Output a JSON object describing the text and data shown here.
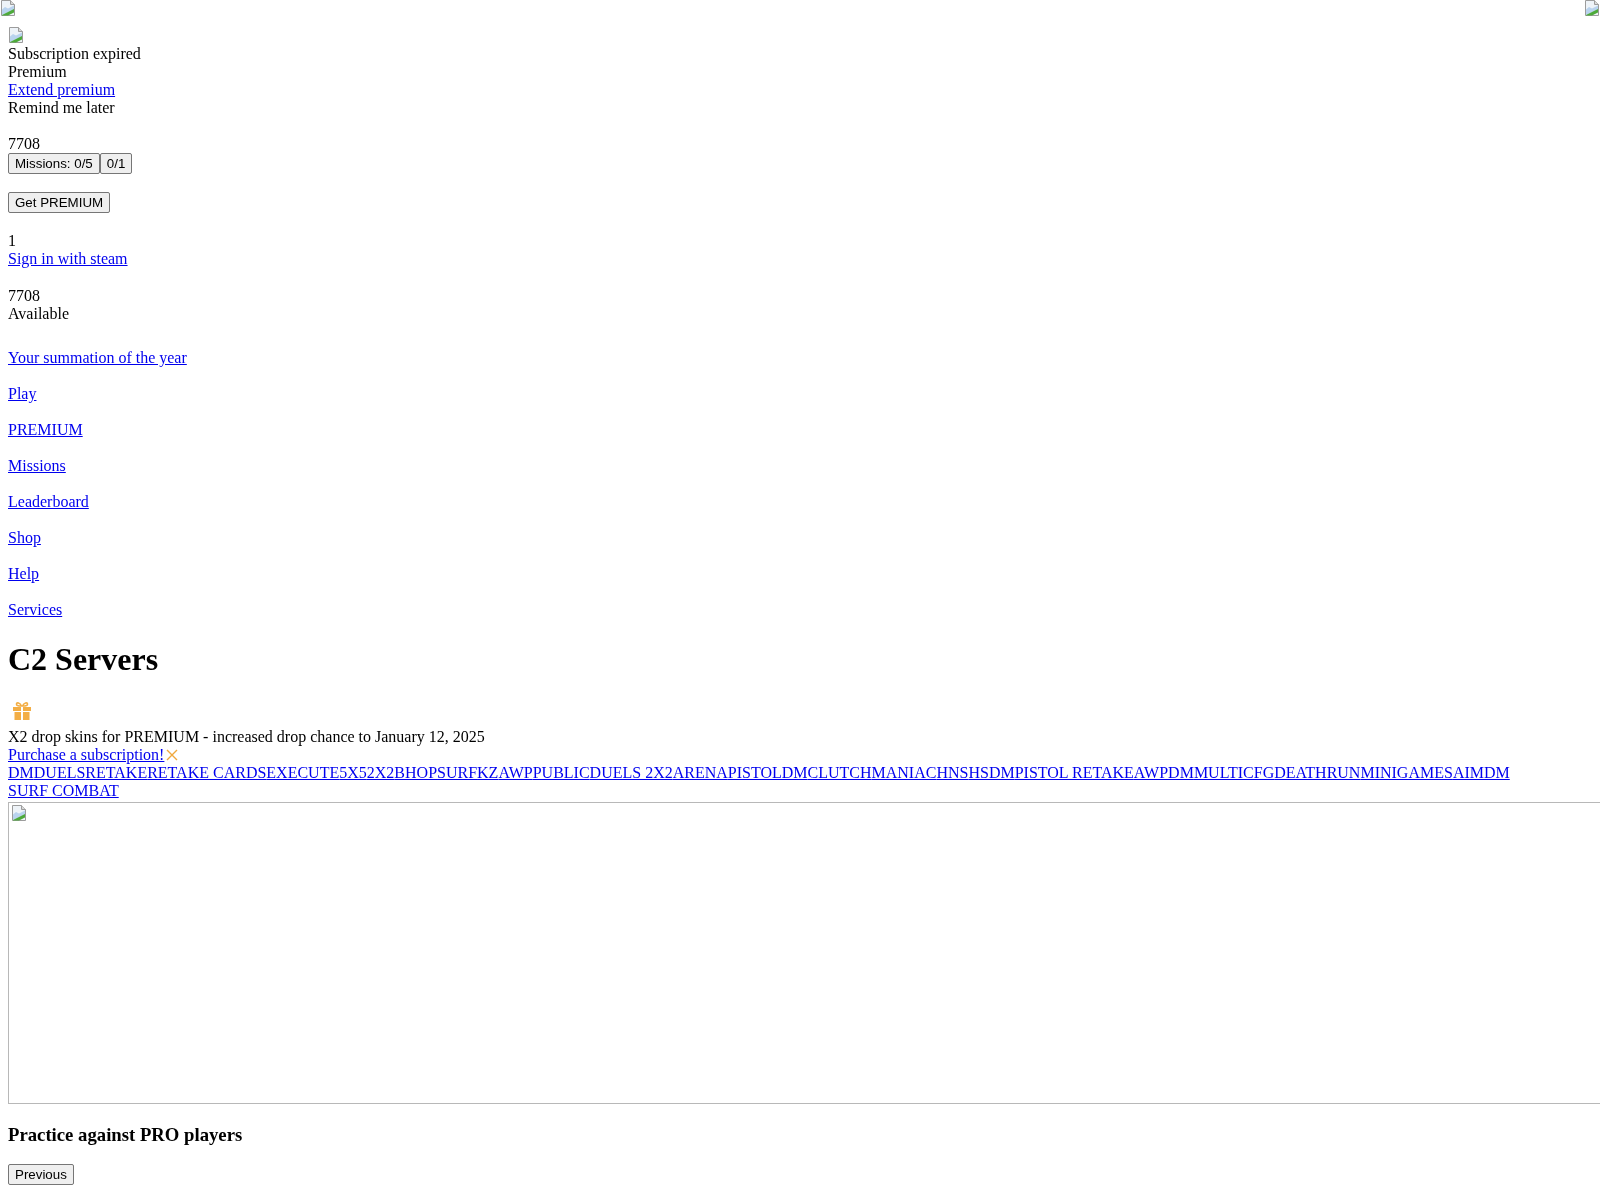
{
  "header": {
    "notice": {
      "title": "Subscription expired",
      "plan": "Premium",
      "extend_link": "Extend premium",
      "dismiss": "Remind me later"
    },
    "balance": "7708",
    "missions_button": "Missions: 0/5",
    "daily_button": "0/1",
    "premium_button": "Get PREMIUM",
    "count": "1",
    "sign_in_link": "Sign in with steam",
    "wallet": {
      "amount": "7708",
      "label": "Available"
    }
  },
  "nav": {
    "items": [
      {
        "label": "Your summation of the year"
      },
      {
        "label": "Play"
      },
      {
        "label": "PREMIUM"
      },
      {
        "label": "Missions"
      },
      {
        "label": "Leaderboard"
      },
      {
        "label": "Shop"
      },
      {
        "label": "Help"
      },
      {
        "label": "Services"
      }
    ]
  },
  "main": {
    "title": "C2 Servers",
    "promo": {
      "text": "X2 drop skins for PREMIUM - increased drop chance to January 12, 2025",
      "link": "Purchase a subscription!"
    },
    "modes": [
      {
        "label": "DM"
      },
      {
        "label": "DUELS"
      },
      {
        "label": "RETAKE"
      },
      {
        "label": "RETAKE CARDS"
      },
      {
        "label": "EXECUTE"
      },
      {
        "label": "5X5"
      },
      {
        "label": "2X2"
      },
      {
        "label": "BHOP"
      },
      {
        "label": "SURF"
      },
      {
        "label": "KZ"
      },
      {
        "label": "AWP"
      },
      {
        "label": "PUBLIC"
      },
      {
        "label": "DUELS 2X2"
      },
      {
        "label": "ARENA"
      },
      {
        "label": "PISTOLDM"
      },
      {
        "label": "CLUTCH"
      },
      {
        "label": "MANIAC"
      },
      {
        "label": "HNS"
      },
      {
        "label": "HSDM"
      },
      {
        "label": "PISTOL RETAKE"
      },
      {
        "label": "AWPDM"
      },
      {
        "label": "MULTICFG"
      },
      {
        "label": "DEATHRUN"
      },
      {
        "label": "MINIGAMES"
      },
      {
        "label": "AIMDM"
      },
      {
        "label": "SURF COMBAT"
      }
    ],
    "slide": {
      "title": "Practice against PRO players"
    },
    "previous_button": "Previous"
  }
}
